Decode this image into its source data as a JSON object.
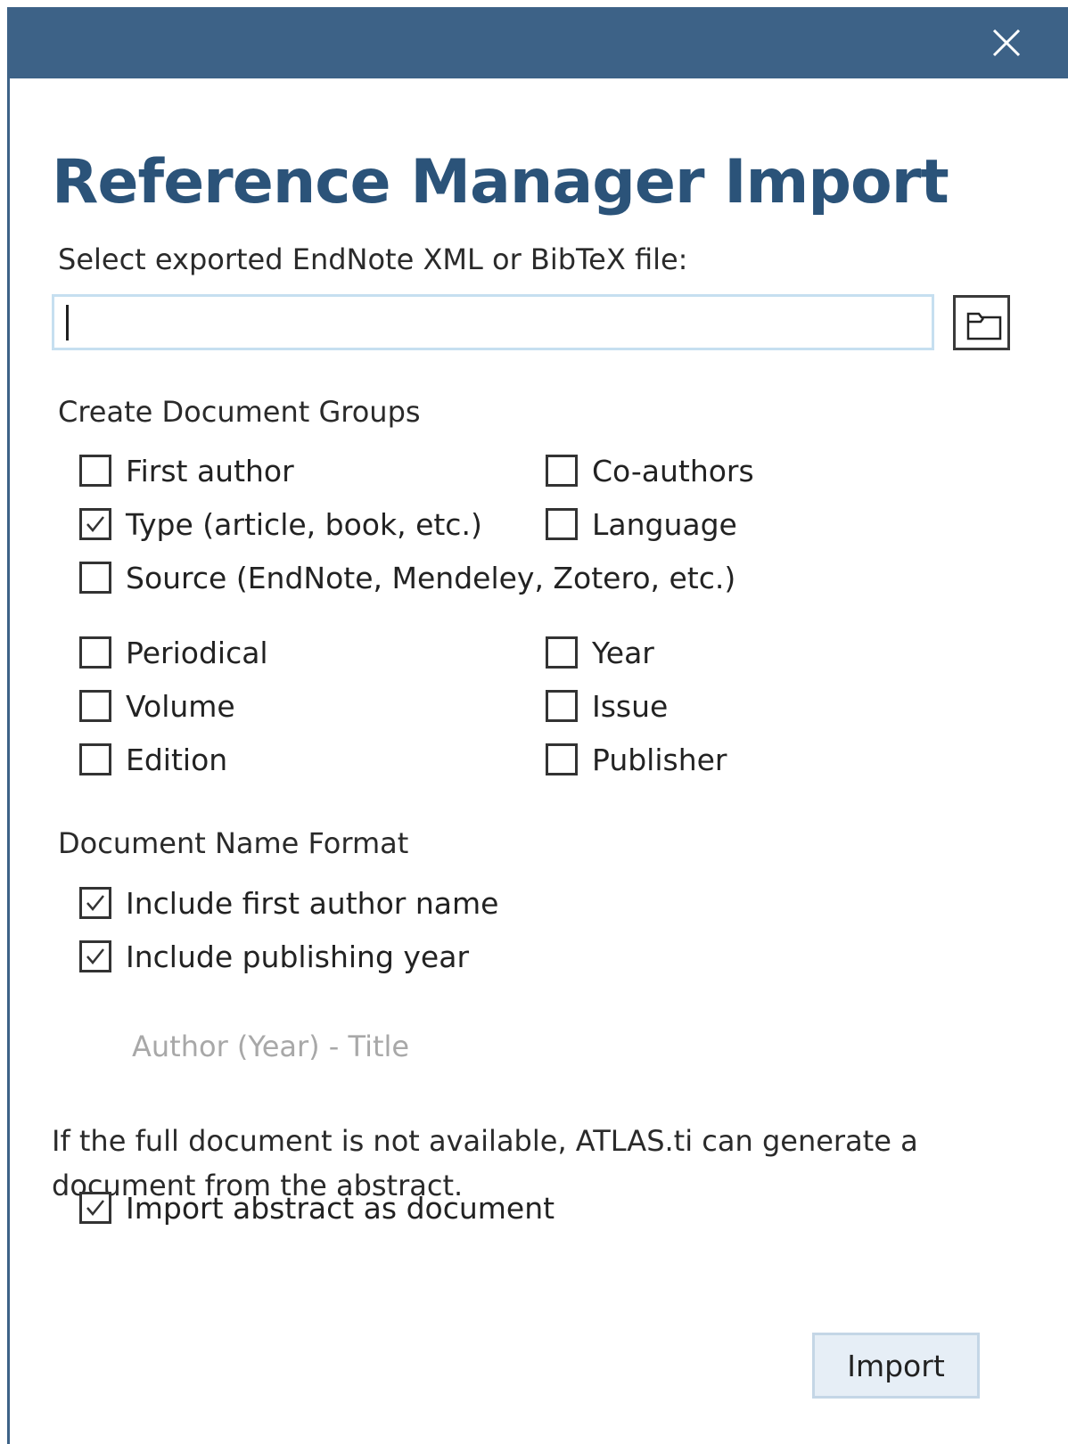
{
  "dialog": {
    "title": "Reference Manager Import",
    "file_label": "Select exported EndNote XML or BibTeX file:",
    "file_value": "",
    "groups_heading": "Create Document Groups",
    "groups": [
      {
        "label": "First author",
        "checked": false
      },
      {
        "label": "Co-authors",
        "checked": false
      },
      {
        "label": "Type (article, book, etc.)",
        "checked": true
      },
      {
        "label": "Language",
        "checked": false
      },
      {
        "label": "Source (EndNote, Mendeley, Zotero, etc.)",
        "checked": false
      },
      {
        "label": "Periodical",
        "checked": false
      },
      {
        "label": "Year",
        "checked": false
      },
      {
        "label": "Volume",
        "checked": false
      },
      {
        "label": "Issue",
        "checked": false
      },
      {
        "label": "Edition",
        "checked": false
      },
      {
        "label": "Publisher",
        "checked": false
      }
    ],
    "name_format_heading": "Document Name Format",
    "name_format": [
      {
        "label": "Include first author name",
        "checked": true
      },
      {
        "label": "Include publishing year",
        "checked": true
      }
    ],
    "name_preview": "Author (Year) - Title",
    "abstract_note": "If the full document is not available, ATLAS.ti can generate a document from the abstract.",
    "abstract_option": {
      "label": "Import abstract as document",
      "checked": true
    },
    "import_button": "Import"
  },
  "icons": {
    "close": "close-icon",
    "browse": "folder-icon",
    "check": "checkmark-icon"
  },
  "colors": {
    "titlebar": "#3d6287",
    "heading": "#2b5379",
    "input_border": "#c6dff0",
    "button_bg": "#e6eef6"
  }
}
